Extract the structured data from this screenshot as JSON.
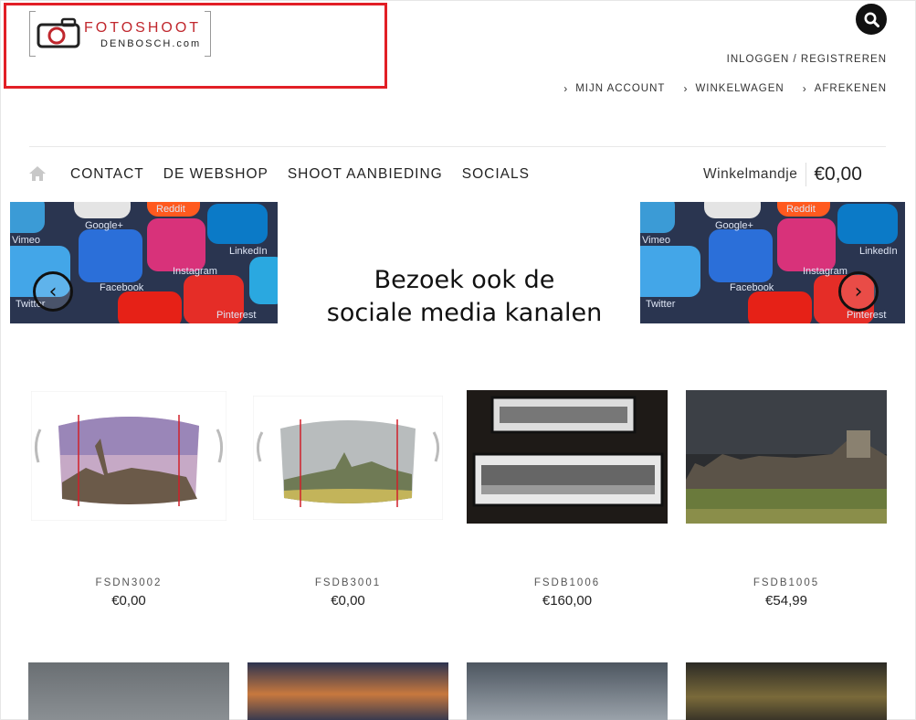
{
  "logo": {
    "line1": "FOTOSHOOT",
    "line2": "DENBOSCH.com",
    "icon": "camera-icon"
  },
  "header": {
    "search_icon": "search-icon",
    "login": "INLOGGEN / REGISTREREN",
    "links": [
      "MIJN ACCOUNT",
      "WINKELWAGEN",
      "AFREKENEN"
    ]
  },
  "nav": {
    "home_icon": "home-icon",
    "items": [
      "CONTACT",
      "DE WEBSHOP",
      "SHOOT AANBIEDING",
      "SOCIALS"
    ]
  },
  "cart": {
    "label": "Winkelmandje",
    "amount": "€0,00"
  },
  "banner": {
    "line1": "Bezoek ook de",
    "line2": "sociale media kanalen",
    "social_labels": [
      "Vimeo",
      "Google+",
      "Reddit",
      "LinkedIn",
      "Twitter",
      "Facebook",
      "Instagram",
      "Pinterest"
    ],
    "prev_icon": "chevron-left-icon",
    "next_icon": "chevron-right-icon"
  },
  "products": [
    {
      "code": "FSDN3002",
      "price": "€0,00"
    },
    {
      "code": "FSDB3001",
      "price": "€0,00"
    },
    {
      "code": "FSDB1006",
      "price": "€160,00"
    },
    {
      "code": "FSDB1005",
      "price": "€54,99"
    }
  ],
  "colors": {
    "brand_red": "#c0272d",
    "highlight": "#e21f26",
    "social_bg": "#2a3550"
  }
}
